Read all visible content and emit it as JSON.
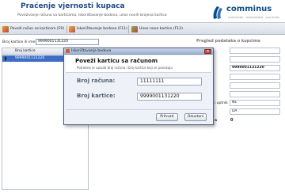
{
  "header": {
    "title": "Praćenje vjernosti kupaca",
    "subtitle": "Povezivanje računa sa karticama, iskorištavanje bodova, unos novih brojeva kartica",
    "logo_text": "comminus",
    "logo_tag": "CONSULTING · DEVELOPMENT · SOLUTIONS"
  },
  "toolbar": {
    "btn1": "Poveži račun sa karticom (F9)",
    "btn2": "Iskorištavanje bodova (F11)",
    "btn3": "Unos nove kartice (F12)"
  },
  "search": {
    "label": "Broj kartice ili ime",
    "value": "9999001131220"
  },
  "grid": {
    "header": "Broj kartice",
    "rows": [
      "9999001131220"
    ]
  },
  "panel": {
    "title": "Pregled podataka o kupcima",
    "value_card": "9999001131220",
    "label_uptnik": "i uptnik",
    "value_ne": "NE",
    "value_da": "DA",
    "label_a": "a",
    "value_zero": "0"
  },
  "dialog": {
    "window_title": "Iskorištavanje bodova",
    "heading": "Poveži karticu sa računom",
    "description": "Potrebno je upisati broj računa i broj kartice koji se povezuju",
    "label_racun": "Broj računa:",
    "value_racun": "11111111",
    "label_kartica": "Broj kartice:",
    "value_kartica": "9999001131220",
    "ok": "Prihvati",
    "cancel": "Odustani"
  },
  "colors": {
    "title": "#1f4a86",
    "selection": "#3e6dc4",
    "close": "#c74a3a"
  }
}
